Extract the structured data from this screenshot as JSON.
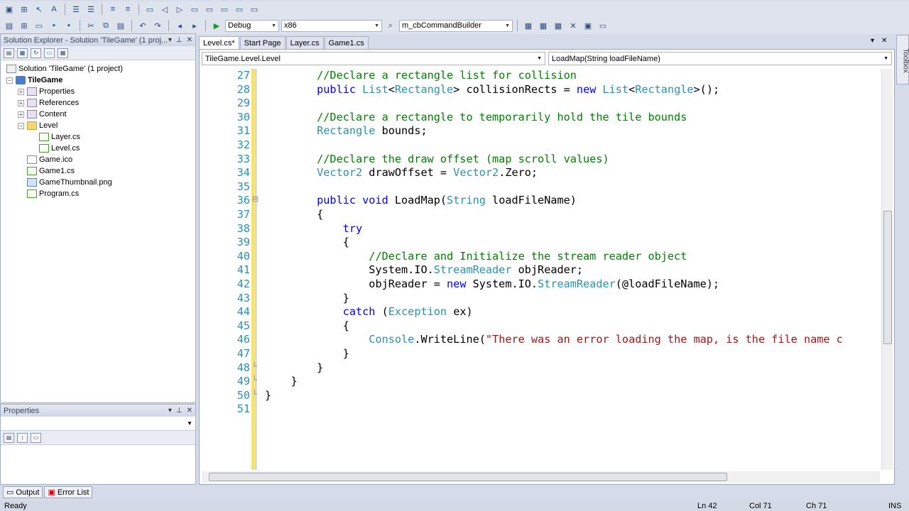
{
  "toolbar": {
    "config": "Debug",
    "platform": "x86",
    "find": "m_cbCommandBuilder"
  },
  "solution_explorer": {
    "title": "Solution Explorer - Solution 'TileGame' (1 proj...",
    "items": [
      {
        "label": "Solution 'TileGame' (1 project)"
      },
      {
        "label": "TileGame"
      },
      {
        "label": "Properties"
      },
      {
        "label": "References"
      },
      {
        "label": "Content"
      },
      {
        "label": "Level"
      },
      {
        "label": "Layer.cs"
      },
      {
        "label": "Level.cs"
      },
      {
        "label": "Game.ico"
      },
      {
        "label": "Game1.cs"
      },
      {
        "label": "GameThumbnail.png"
      },
      {
        "label": "Program.cs"
      }
    ]
  },
  "properties": {
    "title": "Properties"
  },
  "bottom_tabs": [
    {
      "label": "Output"
    },
    {
      "label": "Error List"
    }
  ],
  "document_tabs": [
    {
      "label": "Level.cs*"
    },
    {
      "label": "Start Page"
    },
    {
      "label": "Layer.cs"
    },
    {
      "label": "Game1.cs"
    }
  ],
  "nav": {
    "type": "TileGame.Level.Level",
    "member": "LoadMap(String loadFileName)"
  },
  "toolbox": {
    "label": "Toolbox"
  },
  "code_lines": [
    {
      "n": "27",
      "parts": [
        [
          "c",
          "        //Declare a rectangle list for collision"
        ]
      ]
    },
    {
      "n": "28",
      "parts": [
        [
          "k",
          "        public "
        ],
        [
          "t",
          "List"
        ],
        [
          "p",
          "<"
        ],
        [
          "t",
          "Rectangle"
        ],
        [
          "p",
          "> collisionRects = "
        ],
        [
          "k",
          "new "
        ],
        [
          "t",
          "List"
        ],
        [
          "p",
          "<"
        ],
        [
          "t",
          "Rectangle"
        ],
        [
          "p",
          ">();"
        ]
      ]
    },
    {
      "n": "29",
      "parts": []
    },
    {
      "n": "30",
      "parts": [
        [
          "c",
          "        //Declare a rectangle to temporarily hold the tile bounds"
        ]
      ]
    },
    {
      "n": "31",
      "parts": [
        [
          "t",
          "        Rectangle"
        ],
        [
          "p",
          " bounds;"
        ]
      ]
    },
    {
      "n": "32",
      "parts": []
    },
    {
      "n": "33",
      "parts": [
        [
          "c",
          "        //Declare the draw offset (map scroll values)"
        ]
      ]
    },
    {
      "n": "34",
      "parts": [
        [
          "t",
          "        Vector2"
        ],
        [
          "p",
          " drawOffset = "
        ],
        [
          "t",
          "Vector2"
        ],
        [
          "p",
          ".Zero;"
        ]
      ]
    },
    {
      "n": "35",
      "parts": []
    },
    {
      "n": "36",
      "parts": [
        [
          "k",
          "        public void "
        ],
        [
          "p",
          "LoadMap("
        ],
        [
          "t",
          "String"
        ],
        [
          "p",
          " loadFileName)"
        ]
      ]
    },
    {
      "n": "37",
      "parts": [
        [
          "p",
          "        {"
        ]
      ]
    },
    {
      "n": "38",
      "parts": [
        [
          "k",
          "            try"
        ]
      ]
    },
    {
      "n": "39",
      "parts": [
        [
          "p",
          "            {"
        ]
      ]
    },
    {
      "n": "40",
      "parts": [
        [
          "c",
          "                //Declare and Initialize the stream reader object"
        ]
      ]
    },
    {
      "n": "41",
      "parts": [
        [
          "p",
          "                System.IO."
        ],
        [
          "t",
          "StreamReader"
        ],
        [
          "p",
          " objReader;"
        ]
      ]
    },
    {
      "n": "42",
      "parts": [
        [
          "p",
          "                objReader = "
        ],
        [
          "k",
          "new "
        ],
        [
          "p",
          "System.IO."
        ],
        [
          "t",
          "StreamReader"
        ],
        [
          "p",
          "(@loadFileName);"
        ]
      ]
    },
    {
      "n": "43",
      "parts": [
        [
          "p",
          "            }"
        ]
      ]
    },
    {
      "n": "44",
      "parts": [
        [
          "k",
          "            catch "
        ],
        [
          "p",
          "("
        ],
        [
          "t",
          "Exception"
        ],
        [
          "p",
          " ex)"
        ]
      ]
    },
    {
      "n": "45",
      "parts": [
        [
          "p",
          "            {"
        ]
      ]
    },
    {
      "n": "46",
      "parts": [
        [
          "t",
          "                Console"
        ],
        [
          "p",
          ".WriteLine("
        ],
        [
          "s",
          "\"There was an error loading the map, is the file name c"
        ]
      ]
    },
    {
      "n": "47",
      "parts": [
        [
          "p",
          "            }"
        ]
      ]
    },
    {
      "n": "48",
      "parts": [
        [
          "p",
          "        }"
        ]
      ]
    },
    {
      "n": "49",
      "parts": [
        [
          "p",
          "    }"
        ]
      ]
    },
    {
      "n": "50",
      "parts": [
        [
          "p",
          "}"
        ]
      ]
    },
    {
      "n": "51",
      "parts": []
    }
  ],
  "status": {
    "text": "Ready",
    "ln": "Ln 42",
    "col": "Col 71",
    "ch": "Ch 71",
    "mode": "INS"
  }
}
